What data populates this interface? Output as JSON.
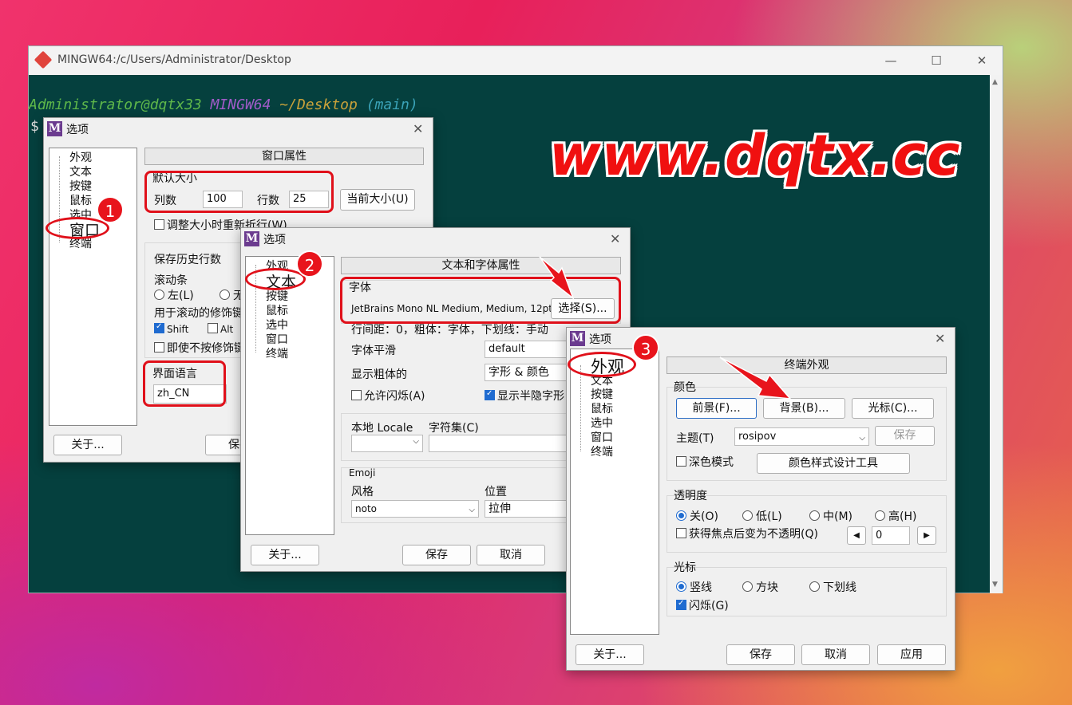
{
  "terminal": {
    "title": "MINGW64:/c/Users/Administrator/Desktop",
    "user_host": "Administrator@dqtx33",
    "env": "MINGW64",
    "path": "~/Desktop",
    "branch": "(main)",
    "prompt_char": "$"
  },
  "watermark": "www.dqtx.cc",
  "markers": [
    "1",
    "2",
    "3"
  ],
  "dialog1": {
    "title": "选项",
    "tree": [
      "外观",
      "文本",
      "按键",
      "鼠标",
      "选中",
      "窗口",
      "终端"
    ],
    "header": "窗口属性",
    "default_size_label": "默认大小",
    "cols_label": "列数",
    "cols_value": "100",
    "rows_label": "行数",
    "rows_value": "25",
    "current_size_btn": "当前大小(U)",
    "rewrap_label": "调整大小时重新折行(W)",
    "history_label": "保存历史行数",
    "scrollbar_label": "滚动条",
    "left_label": "左(L)",
    "none_label": "无",
    "modifier_label": "用于滚动的修饰键",
    "shift_label": "Shift",
    "alt_label": "Alt",
    "no_modifier_label": "即使不按修饰键",
    "ui_lang_label": "界面语言",
    "ui_lang_value": "zh_CN",
    "about_btn": "关于...",
    "save_btn": "保存"
  },
  "dialog2": {
    "title": "选项",
    "tree": [
      "外观",
      "文本",
      "按键",
      "鼠标",
      "选中",
      "窗口",
      "终端"
    ],
    "header": "文本和字体属性",
    "font_group": "字体",
    "font_value": "JetBrains Mono NL Medium, Medium, 12pt",
    "select_btn": "选择(S)...",
    "spacing_text": "行间距：0，粗体：字体，下划线：手动",
    "smoothing_label": "字体平滑",
    "smoothing_value": "default",
    "bold_label": "显示粗体的",
    "bold_value": "字形 & 颜色",
    "blink_label": "允许闪烁(A)",
    "dim_label": "显示半隐字形",
    "locale_label": "本地 Locale",
    "charset_label": "字符集(C)",
    "emoji_group": "Emoji",
    "style_label": "风格",
    "style_value": "noto",
    "position_label": "位置",
    "position_value": "拉伸",
    "about_btn": "关于...",
    "save_btn": "保存",
    "cancel_btn": "取消"
  },
  "dialog3": {
    "title": "选项",
    "tree": [
      "外观",
      "文本",
      "按键",
      "鼠标",
      "选中",
      "窗口",
      "终端"
    ],
    "header": "终端外观",
    "color_group": "颜色",
    "fg_btn": "前景(F)...",
    "bg_btn": "背景(B)...",
    "cursor_btn": "光标(C)...",
    "theme_label": "主题(T)",
    "theme_value": "rosipov",
    "theme_save_btn": "保存",
    "dark_mode_label": "深色模式",
    "scheme_tool_btn": "颜色样式设计工具",
    "transparency_group": "透明度",
    "trans_off": "关(O)",
    "trans_low": "低(L)",
    "trans_mid": "中(M)",
    "trans_high": "高(H)",
    "opaque_focus_label": "获得焦点后变为不透明(Q)",
    "trans_value": "0",
    "cursor_group": "光标",
    "cursor_line": "竖线",
    "cursor_block": "方块",
    "cursor_underline": "下划线",
    "blink_label": "闪烁(G)",
    "about_btn": "关于...",
    "save_btn": "保存",
    "cancel_btn": "取消",
    "apply_btn": "应用"
  },
  "colors": {
    "terminal_bg": "#05403e",
    "prompt_user": "#5fb84a",
    "prompt_env": "#a05bc8",
    "prompt_path": "#c9a23a",
    "prompt_branch": "#3ba3b8",
    "annotation_red": "#e0101a"
  }
}
